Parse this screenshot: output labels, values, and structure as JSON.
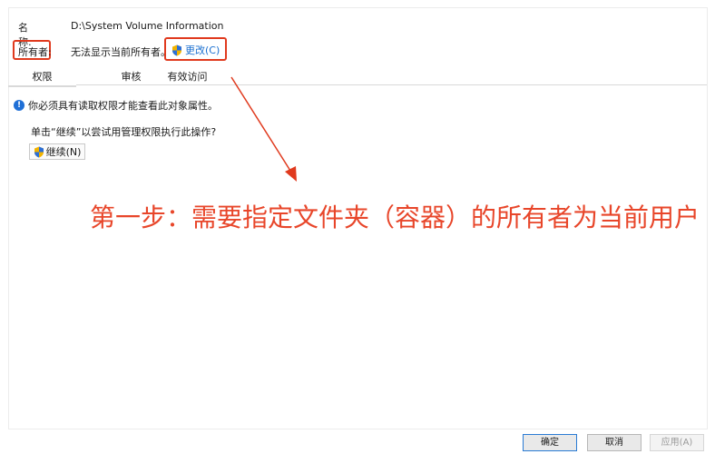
{
  "name_row": {
    "label": "名称:",
    "value": "D:\\System Volume Information"
  },
  "owner_row": {
    "label": "所有者:",
    "value": "无法显示当前所有者。",
    "change_label": "更改(C)"
  },
  "tabs": [
    {
      "label": "权限"
    },
    {
      "label": "审核"
    },
    {
      "label": "有效访问"
    }
  ],
  "notice": {
    "text": "你必须具有读取权限才能查看此对象属性。"
  },
  "prompt": {
    "text": "单击“继续”以尝试用管理权限执行此操作?"
  },
  "continue_button": {
    "label": "继续(N)"
  },
  "annotation": {
    "text": "第一步：需要指定文件夹（容器）的所有者为当前用户",
    "color": "#e8462a"
  },
  "footer": {
    "ok": "确定",
    "cancel": "取消",
    "apply": "应用(A)"
  },
  "colors": {
    "highlight_box": "#e03a1e",
    "link": "#1a6fd0",
    "info": "#1f6fd6"
  },
  "icons": {
    "shield": "uac-shield-icon",
    "info": "info-icon"
  }
}
